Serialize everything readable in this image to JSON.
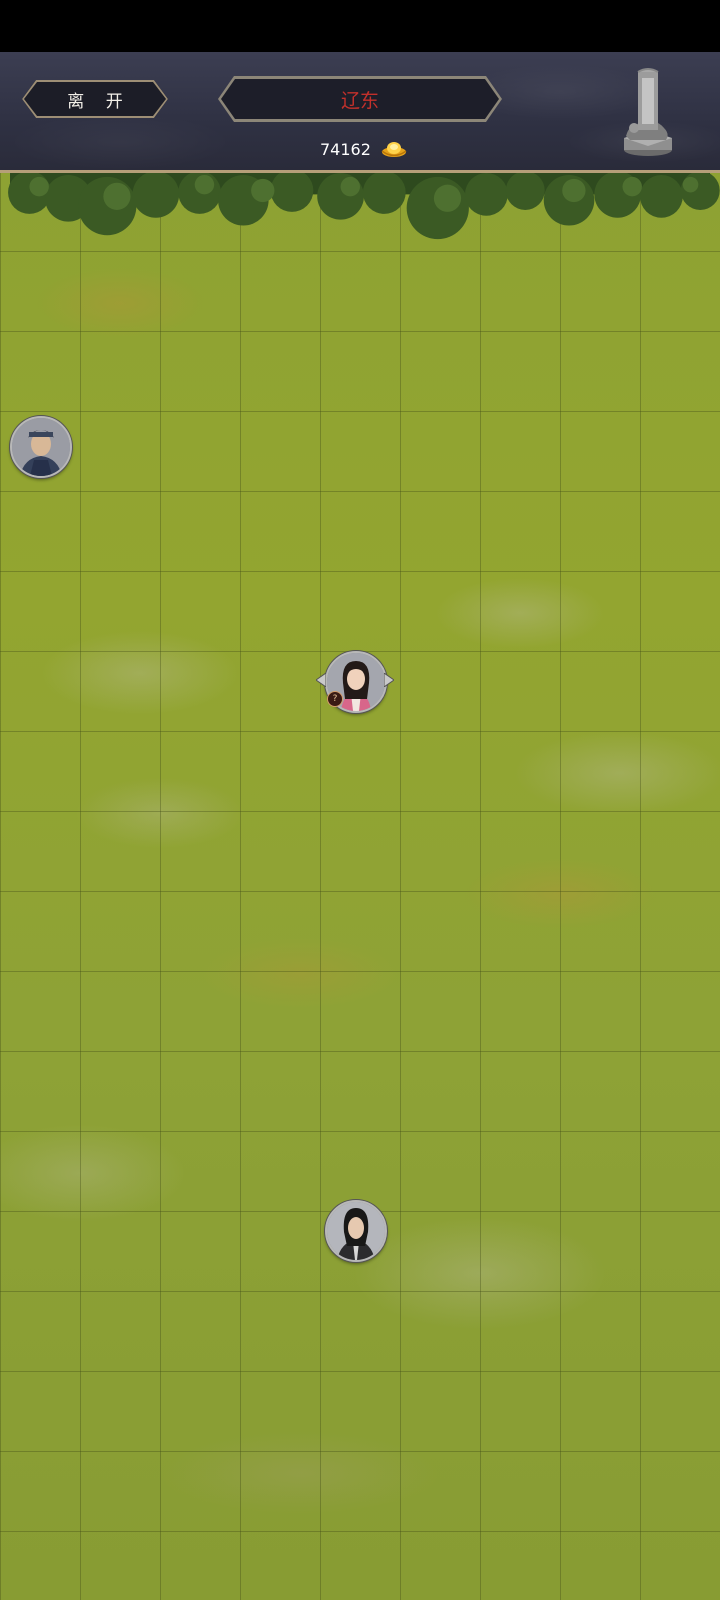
{
  "header": {
    "leave_label": "离 开",
    "title": "辽东",
    "gold_amount": "74162",
    "gold_icon": "gold-ingot-icon",
    "monument_icon": "stone-stele-icon"
  },
  "colors": {
    "title_text": "#c2302b",
    "header_bg": "#34364a",
    "header_border": "#b69f79",
    "grass": "#8ea233"
  },
  "units": [
    {
      "name": "unit-warrior-helmet",
      "icon": "warrior-portrait"
    },
    {
      "name": "unit-woman-pink",
      "icon": "woman-portrait",
      "badge": "?"
    },
    {
      "name": "unit-swordsman-black",
      "icon": "man-portrait"
    }
  ]
}
